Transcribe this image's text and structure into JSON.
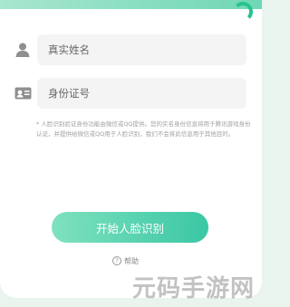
{
  "form": {
    "name_label": "真实姓名",
    "id_label": "身份证号"
  },
  "notice": "* 人脸识别验证身份功能由微信或QQ提供。您的实名身份信息将用于腾讯游戏身份认证，并提供给微信或QQ用于人脸识别，我们不会将此信息用于其他目的。",
  "actions": {
    "start_label": "开始人脸识别",
    "help_label": "帮助",
    "help_icon": "?"
  },
  "watermark": "元码手游网",
  "colors": {
    "accent_start": "#7fe1bf",
    "accent_end": "#3ac7a4",
    "field_bg": "#f4f4f4"
  }
}
